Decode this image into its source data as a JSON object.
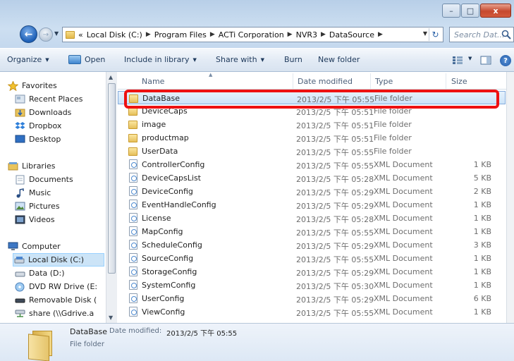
{
  "window": {
    "caption_buttons": {
      "minimize": "–",
      "maximize": "□",
      "close": "x"
    }
  },
  "address": {
    "overflow_marker": "«",
    "crumbs": [
      "Local Disk (C:)",
      "Program Files",
      "ACTi Corporation",
      "NVR3",
      "DataSource"
    ]
  },
  "search": {
    "placeholder": "Search Dat..."
  },
  "toolbar": {
    "organize": "Organize",
    "open": "Open",
    "include_in_library": "Include in library",
    "share_with": "Share with",
    "burn": "Burn",
    "new_folder": "New folder"
  },
  "navpane": {
    "favorites": "Favorites",
    "recent_places": "Recent Places",
    "downloads": "Downloads",
    "dropbox": "Dropbox",
    "desktop": "Desktop",
    "libraries": "Libraries",
    "documents": "Documents",
    "music": "Music",
    "pictures": "Pictures",
    "videos": "Videos",
    "computer": "Computer",
    "local_disk": "Local Disk (C:)",
    "data_d": "Data (D:)",
    "dvd": "DVD RW Drive (E:",
    "removable": "Removable Disk (",
    "share": "share (\\\\Gdrive.a"
  },
  "columns": {
    "name": "Name",
    "date": "Date modified",
    "type": "Type",
    "size": "Size"
  },
  "files": [
    {
      "name": "DataBase",
      "date": "2013/2/5 下午 05:55",
      "type": "File folder",
      "size": ""
    },
    {
      "name": "DeviceCaps",
      "date": "2013/2/5 下午 05:51",
      "type": "File folder",
      "size": ""
    },
    {
      "name": "image",
      "date": "2013/2/5 下午 05:51",
      "type": "File folder",
      "size": ""
    },
    {
      "name": "productmap",
      "date": "2013/2/5 下午 05:51",
      "type": "File folder",
      "size": ""
    },
    {
      "name": "UserData",
      "date": "2013/2/5 下午 05:55",
      "type": "File folder",
      "size": ""
    },
    {
      "name": "ControllerConfig",
      "date": "2013/2/5 下午 05:55",
      "type": "XML Document",
      "size": "1 KB"
    },
    {
      "name": "DeviceCapsList",
      "date": "2013/2/5 下午 05:28",
      "type": "XML Document",
      "size": "5 KB"
    },
    {
      "name": "DeviceConfig",
      "date": "2013/2/5 下午 05:29",
      "type": "XML Document",
      "size": "2 KB"
    },
    {
      "name": "EventHandleConfig",
      "date": "2013/2/5 下午 05:29",
      "type": "XML Document",
      "size": "1 KB"
    },
    {
      "name": "License",
      "date": "2013/2/5 下午 05:28",
      "type": "XML Document",
      "size": "1 KB"
    },
    {
      "name": "MapConfig",
      "date": "2013/2/5 下午 05:55",
      "type": "XML Document",
      "size": "1 KB"
    },
    {
      "name": "ScheduleConfig",
      "date": "2013/2/5 下午 05:29",
      "type": "XML Document",
      "size": "3 KB"
    },
    {
      "name": "SourceConfig",
      "date": "2013/2/5 下午 05:55",
      "type": "XML Document",
      "size": "1 KB"
    },
    {
      "name": "StorageConfig",
      "date": "2013/2/5 下午 05:29",
      "type": "XML Document",
      "size": "1 KB"
    },
    {
      "name": "SystemConfig",
      "date": "2013/2/5 下午 05:30",
      "type": "XML Document",
      "size": "1 KB"
    },
    {
      "name": "UserConfig",
      "date": "2013/2/5 下午 05:29",
      "type": "XML Document",
      "size": "6 KB"
    },
    {
      "name": "ViewConfig",
      "date": "2013/2/5 下午 05:55",
      "type": "XML Document",
      "size": "1 KB"
    }
  ],
  "details": {
    "name": "DataBase",
    "modified_label": "Date modified:",
    "modified_value": "2013/2/5 下午 05:55",
    "type": "File folder"
  },
  "colors": {
    "highlight": "#ee1111",
    "selection": "#cde3f8"
  }
}
